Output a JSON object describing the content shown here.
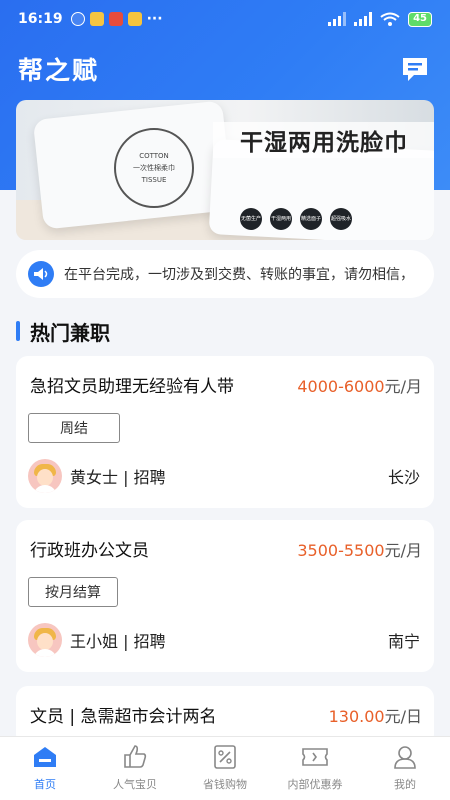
{
  "status_bar": {
    "time": "16:19",
    "battery": "45"
  },
  "app": {
    "title": "帮之赋"
  },
  "banner": {
    "title": "干湿两用洗脸巾",
    "pack_text": [
      "COTTON",
      "一次性棉柔巾",
      "TISSUE"
    ],
    "badges": [
      "无菌生产",
      "干湿两用",
      "精选面子",
      "超强吸水"
    ]
  },
  "notice": {
    "text": "在平台完成，一切涉及到交费、转账的事宜，请勿相信，"
  },
  "section": {
    "title": "热门兼职"
  },
  "jobs": [
    {
      "title": "急招文员助理无经验有人带",
      "salary": "4000-6000",
      "unit": "元/月",
      "tag": "周结",
      "recruiter": "黄女士 | 招聘",
      "city": "长沙"
    },
    {
      "title": "行政班办公文员",
      "salary": "3500-5500",
      "unit": "元/月",
      "tag": "按月结算",
      "recruiter": "王小姐 | 招聘",
      "city": "南宁"
    },
    {
      "title": "文员 | 急需超市会计两名",
      "salary": "130.00",
      "unit": "元/日"
    }
  ],
  "nav": [
    {
      "label": "首页",
      "icon": "home-icon",
      "active": true
    },
    {
      "label": "人气宝贝",
      "icon": "thumbs-up-icon"
    },
    {
      "label": "省钱购物",
      "icon": "discount-icon"
    },
    {
      "label": "内部优惠券",
      "icon": "coupon-icon"
    },
    {
      "label": "我的",
      "icon": "user-icon"
    }
  ],
  "colors": {
    "primary": "#2f7df5",
    "salary": "#e8602a"
  }
}
